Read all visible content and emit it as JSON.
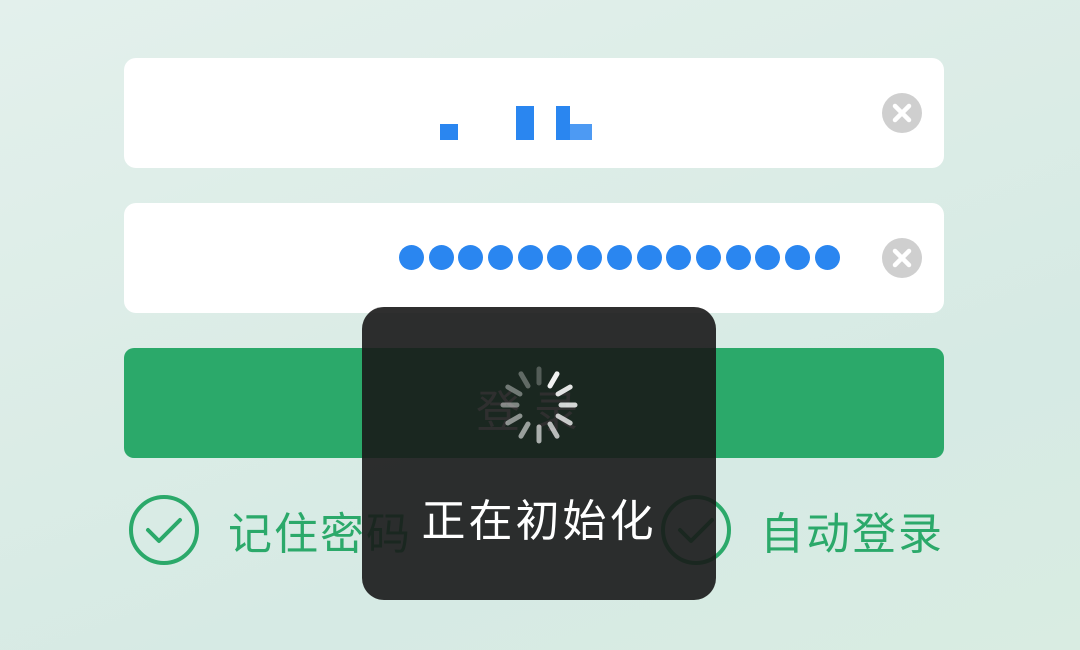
{
  "form": {
    "username": {
      "value_masked": true,
      "clear_icon": "clear-circle-icon"
    },
    "password": {
      "dot_count": 15,
      "clear_icon": "clear-circle-icon"
    },
    "login_button": {
      "label": "登录"
    },
    "options": [
      {
        "label": "记住密码",
        "checked": true,
        "icon": "check-circle-icon"
      },
      {
        "label": "自动登录",
        "checked": true,
        "icon": "check-circle-icon"
      }
    ]
  },
  "loading_toast": {
    "text": "正在初始化",
    "icon": "spinner-icon"
  },
  "colors": {
    "accent_green": "#2ba96a",
    "input_blue": "#2a86f0",
    "clear_gray": "#cfcfcf",
    "toast_bg": "#181818"
  }
}
